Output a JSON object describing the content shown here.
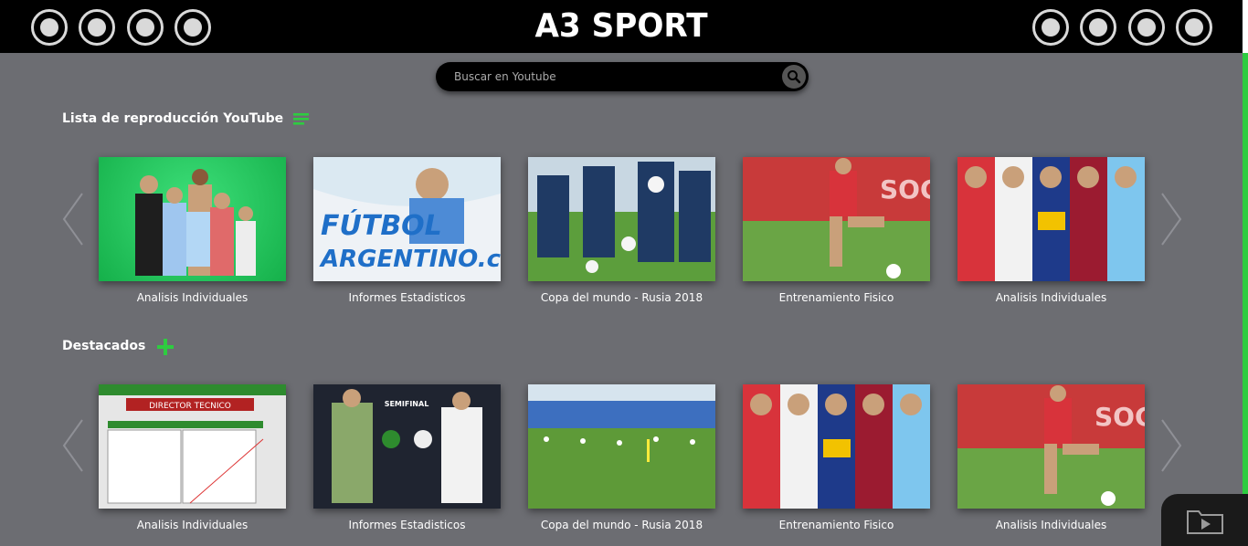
{
  "app": {
    "title": "A3 SPORT"
  },
  "search": {
    "placeholder": "Buscar en Youtube",
    "icon": "search-icon"
  },
  "sections": [
    {
      "title": "Lista de reproducción YouTube",
      "icon": "playlist-icon",
      "items": [
        {
          "caption": "Analisis Individuales",
          "thumb_theme": "green-retro-players"
        },
        {
          "caption": "Informes Estadisticos",
          "thumb_theme": "futbol-argentino-logo",
          "thumb_text": "FÚTBOL ARGENTINO.com"
        },
        {
          "caption": "Copa del mundo - Rusia 2018",
          "thumb_theme": "training-players"
        },
        {
          "caption": "Entrenamiento Fisico",
          "thumb_theme": "player-kicking-red"
        },
        {
          "caption": "Analisis Individuales",
          "thumb_theme": "five-players-collage"
        }
      ]
    },
    {
      "title": "Destacados",
      "icon": "plus-icon",
      "items": [
        {
          "caption": "Analisis Individuales",
          "thumb_theme": "software-screen",
          "thumb_text": "DIRECTOR TECNICO"
        },
        {
          "caption": "Informes Estadisticos",
          "thumb_theme": "semifinal-matchup",
          "thumb_text": "SEMIFINAL"
        },
        {
          "caption": "Copa del mundo - Rusia 2018",
          "thumb_theme": "training-field"
        },
        {
          "caption": "Entrenamiento Fisico",
          "thumb_theme": "five-players-collage"
        },
        {
          "caption": "Analisis Individuales",
          "thumb_theme": "player-kicking-red"
        }
      ]
    }
  ],
  "colors": {
    "accent": "#2ecc40",
    "background": "#6c6d72",
    "topbar": "#000000"
  },
  "corner": {
    "icon": "video-folder-icon"
  }
}
